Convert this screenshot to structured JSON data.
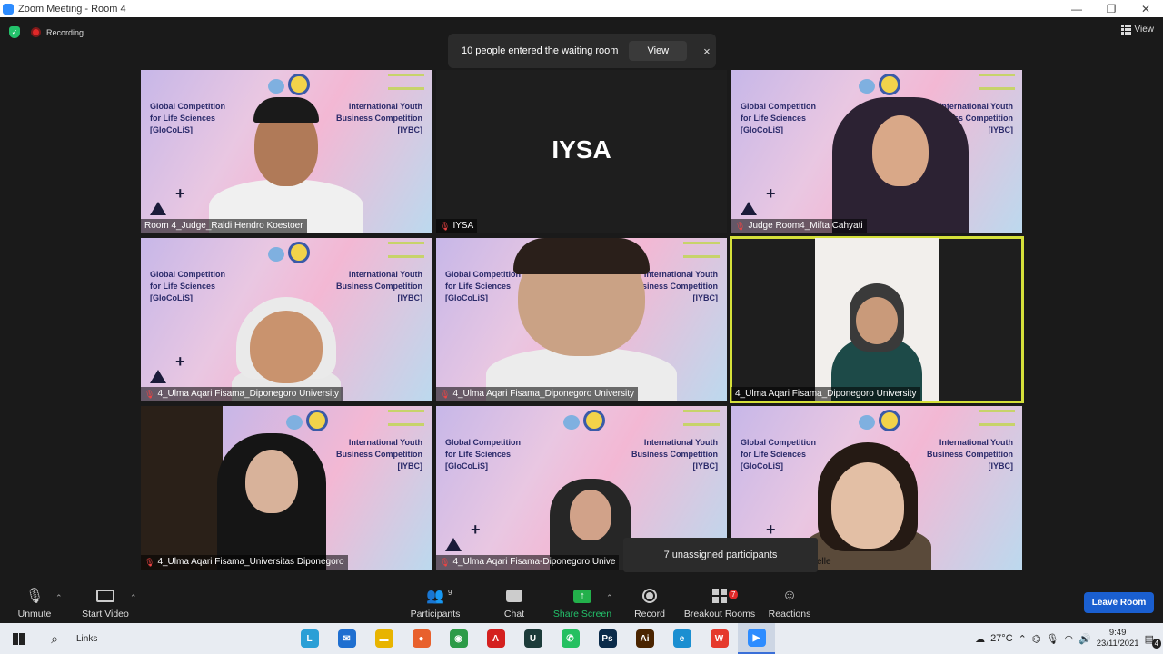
{
  "window": {
    "title": "Zoom Meeting - Room 4",
    "controls": [
      "—",
      "❐",
      "✕"
    ]
  },
  "status": {
    "recording_label": "Recording",
    "view_label": "View"
  },
  "notification": {
    "text": "10 people entered the waiting room",
    "button": "View",
    "close": "×"
  },
  "background": {
    "left_lines": [
      "Global Competition",
      "for Life Sciences",
      "[GloCoLiS]"
    ],
    "right_lines": [
      "International Youth",
      "Business Competition",
      "[IYBC]"
    ],
    "logo_text": "GloCoLiS"
  },
  "tiles": [
    {
      "name": "Room 4_Judge_Raldi Hendro Koestoer",
      "muted": false
    },
    {
      "name": "IYSA",
      "muted": true,
      "display_text": "IYSA"
    },
    {
      "name": "Judge Room4_Mifta Cahyati",
      "muted": true
    },
    {
      "name": "4_Ulma Aqari Fisama_Diponegoro University",
      "muted": true
    },
    {
      "name": "4_Ulma Aqari Fisama_Diponegoro University",
      "muted": true
    },
    {
      "name": "4_Ulma Aqari Fisama_Diponegoro University",
      "muted": false
    },
    {
      "name": "4_Ulma Aqari Fisama_Universitas Diponegoro",
      "muted": true
    },
    {
      "name": "4_Ulma Aqari Fisama-Diponegoro Unive",
      "muted": true
    },
    {
      "name": "elle",
      "muted": false
    }
  ],
  "toast": {
    "text": "7 unassigned participants"
  },
  "toolbar": {
    "unmute": "Unmute",
    "start_video": "Start Video",
    "participants": "Participants",
    "participants_count": "9",
    "chat": "Chat",
    "share_screen": "Share Screen",
    "record": "Record",
    "breakout_rooms": "Breakout Rooms",
    "breakout_count": "7",
    "reactions": "Reactions",
    "leave": "Leave Room"
  },
  "taskbar": {
    "links": "Links",
    "apps": [
      {
        "name": "l-app",
        "glyph": "L",
        "color": "#2a9fd6"
      },
      {
        "name": "mail",
        "glyph": "✉",
        "color": "#1f6fd0"
      },
      {
        "name": "file-explorer",
        "glyph": "▬",
        "color": "#e8b400"
      },
      {
        "name": "firefox",
        "glyph": "●",
        "color": "#e8602c"
      },
      {
        "name": "chrome",
        "glyph": "◉",
        "color": "#2d9b48"
      },
      {
        "name": "acrobat",
        "glyph": "A",
        "color": "#d4201f"
      },
      {
        "name": "u-app",
        "glyph": "U",
        "color": "#1c3b3a"
      },
      {
        "name": "whatsapp",
        "glyph": "✆",
        "color": "#25c061"
      },
      {
        "name": "photoshop",
        "glyph": "Ps",
        "color": "#0b2b4a"
      },
      {
        "name": "illustrator",
        "glyph": "Ai",
        "color": "#4a2400"
      },
      {
        "name": "edge",
        "glyph": "e",
        "color": "#1b8fd1"
      },
      {
        "name": "wps",
        "glyph": "W",
        "color": "#e5392c"
      },
      {
        "name": "zoom",
        "glyph": "▶",
        "color": "#2d8cff"
      }
    ],
    "temperature": "27°C",
    "time": "9:49",
    "date": "23/11/2021",
    "notifications": "4"
  }
}
